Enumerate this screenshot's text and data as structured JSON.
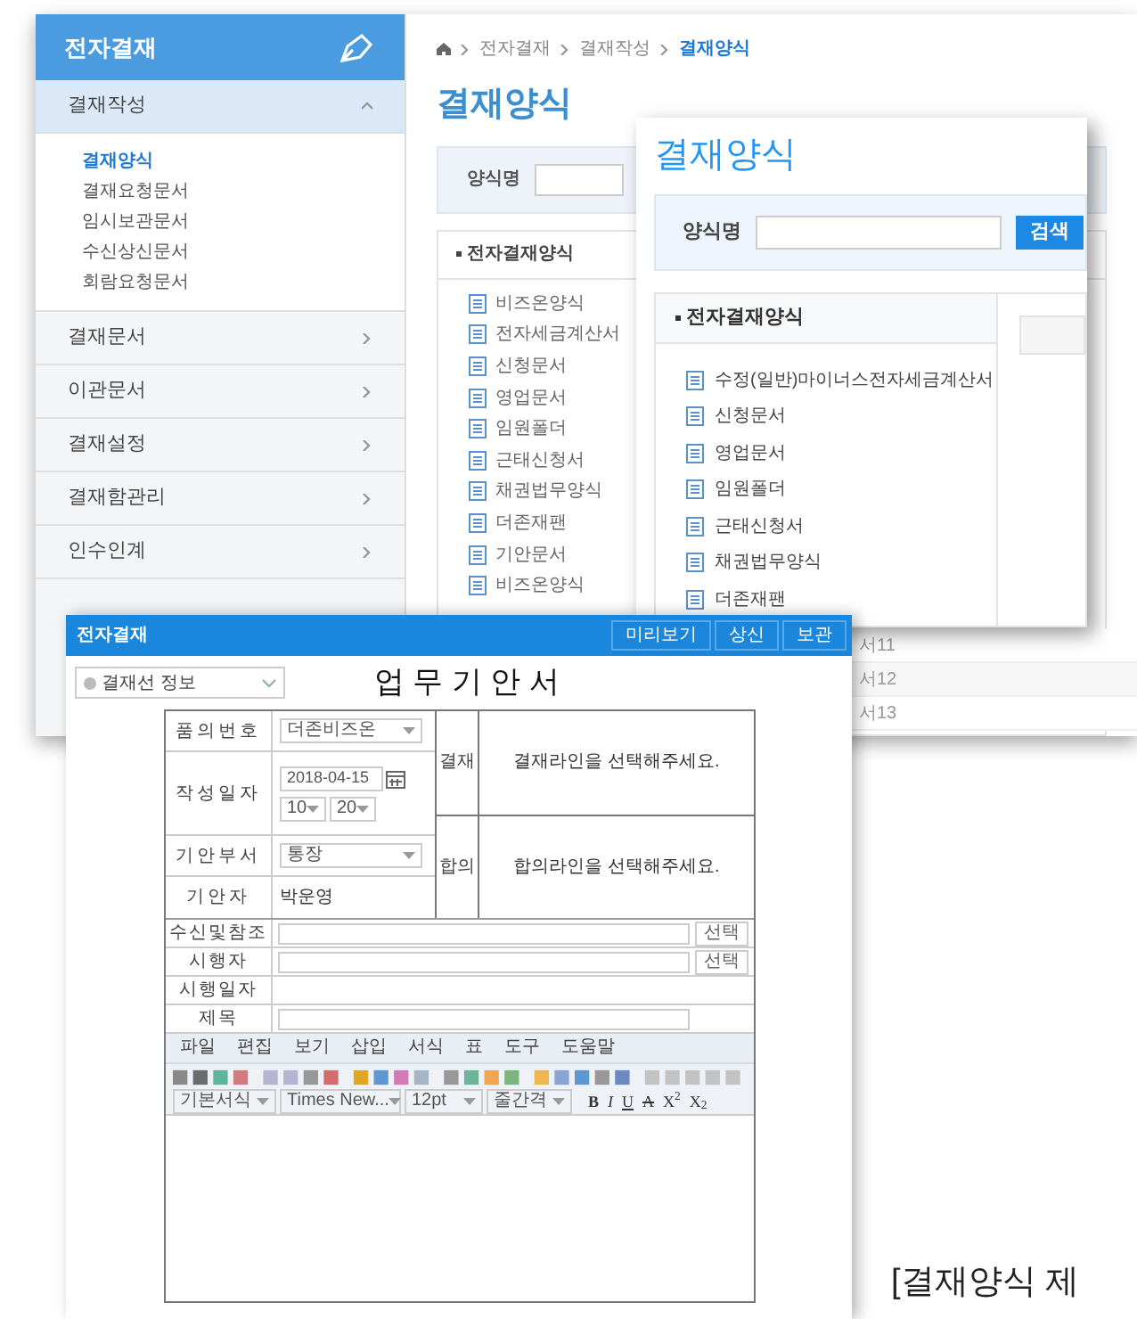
{
  "background_app": {
    "sidebar": {
      "title": "전자결재",
      "sections": [
        {
          "label": "결재작성",
          "expanded": true,
          "children": [
            {
              "label": "결재양식",
              "selected": true
            },
            {
              "label": "결재요청문서",
              "selected": false
            },
            {
              "label": "임시보관문서",
              "selected": false
            },
            {
              "label": "수신상신문서",
              "selected": false
            },
            {
              "label": "회람요청문서",
              "selected": false
            }
          ]
        },
        {
          "label": "결재문서",
          "expanded": false
        },
        {
          "label": "이관문서",
          "expanded": false
        },
        {
          "label": "결재설정",
          "expanded": false
        },
        {
          "label": "결재함관리",
          "expanded": false
        },
        {
          "label": "인수인계",
          "expanded": false
        }
      ]
    },
    "breadcrumb": [
      "전자결재",
      "결재작성",
      "결재양식"
    ],
    "page_title": "결재양식",
    "search_label": "양식명",
    "list_header": "전자결재양식",
    "list_items": [
      "비즈온양식",
      "전자세금계산서",
      "신청문서",
      "영업문서",
      "임원폴더",
      "근태신청서",
      "채권법무양식",
      "더존재팬",
      "기안문서",
      "비즈온양식"
    ],
    "table_fragment": [
      "서11",
      "서12",
      "서13"
    ]
  },
  "zoom_popup": {
    "title": "결재양식",
    "search_label": "양식명",
    "search_button": "검색",
    "list_header": "전자결재양식",
    "list_items": [
      "수정(일반)마이너스전자세금계산서",
      "신청문서",
      "영업문서",
      "임원폴더",
      "근태신청서",
      "채권법무양식",
      "더존재팬"
    ]
  },
  "form_window": {
    "title": "전자결재",
    "buttons": [
      "미리보기",
      "상신",
      "보관"
    ],
    "approval_dropdown": "결재선 정보",
    "doc_title": "업 무 기 안 서",
    "fields": [
      {
        "label": "품의번호",
        "kind": "select",
        "value": "더존비즈온"
      },
      {
        "label": "작성일자",
        "kind": "datetime",
        "value": "2018-04-15",
        "hour": "10",
        "minute": "20"
      },
      {
        "label": "기안부서",
        "kind": "select",
        "value": "통장"
      },
      {
        "label": "기안자",
        "kind": "text",
        "value": "박운영"
      }
    ],
    "approval_lines": [
      {
        "label": "결재",
        "hint": "결재라인을 선택해주세요."
      },
      {
        "label": "합의",
        "hint": "합의라인을 선택해주세요."
      }
    ],
    "rows": [
      {
        "label": "수신및참조",
        "kind": "input_button",
        "button": "선택"
      },
      {
        "label": "시행자",
        "kind": "input_button",
        "button": "선택"
      },
      {
        "label": "시행일자",
        "kind": "plain"
      },
      {
        "label": "제목",
        "kind": "input"
      }
    ],
    "editor": {
      "menu": [
        "파일",
        "편집",
        "보기",
        "삽입",
        "서식",
        "표",
        "도구",
        "도움말"
      ],
      "selects": [
        "기본서식",
        "Times New...",
        "12pt",
        "줄간격"
      ],
      "format_buttons": [
        "B",
        "I",
        "U",
        "A",
        "X$^{2}$",
        "X$_{2}$"
      ]
    }
  },
  "caption": "[결재양식 제"
}
